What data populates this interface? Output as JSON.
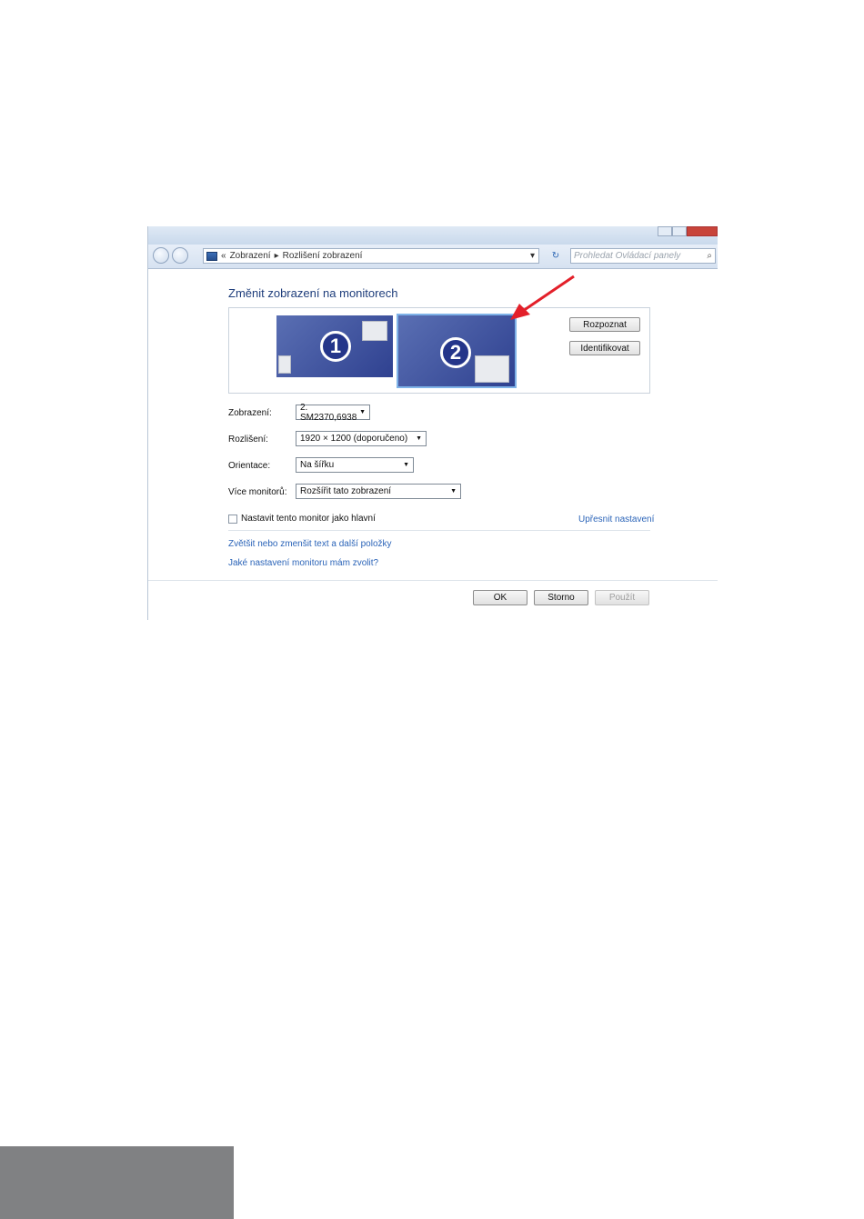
{
  "address": {
    "prefix": "«",
    "path": [
      "Zobrazení",
      "Rozlišení zobrazení"
    ],
    "separator": "▸",
    "dropdown": "▾",
    "refresh": "↻",
    "search_placeholder": "Prohledat Ovládací panely",
    "search_icon": "⌕"
  },
  "heading": "Změnit zobrazení na monitorech",
  "monitors": [
    {
      "label": "1"
    },
    {
      "label": "2"
    }
  ],
  "buttons": {
    "detect": "Rozpoznat",
    "identify": "Identifikovat",
    "ok": "OK",
    "cancel": "Storno",
    "apply": "Použít"
  },
  "fields": {
    "display_label": "Zobrazení:",
    "display_value": "2. SM2370,6938",
    "resolution_label": "Rozlišení:",
    "resolution_value": "1920 × 1200 (doporučeno)",
    "orientation_label": "Orientace:",
    "orientation_value": "Na šířku",
    "multi_label": "Více monitorů:",
    "multi_value": "Rozšířit tato zobrazení"
  },
  "checkbox_label": "Nastavit tento monitor jako hlavní",
  "links": {
    "advanced": "Upřesnit nastavení",
    "text_size": "Zvětšit nebo zmenšit text a další položky",
    "which_settings": "Jaké nastavení monitoru mám zvolit?"
  },
  "colors": {
    "accent_arrow": "#e3202a",
    "link": "#2b64b8",
    "monitor_blue": "#2f4190"
  },
  "icons": {
    "dropdown_arrow": "▼"
  }
}
